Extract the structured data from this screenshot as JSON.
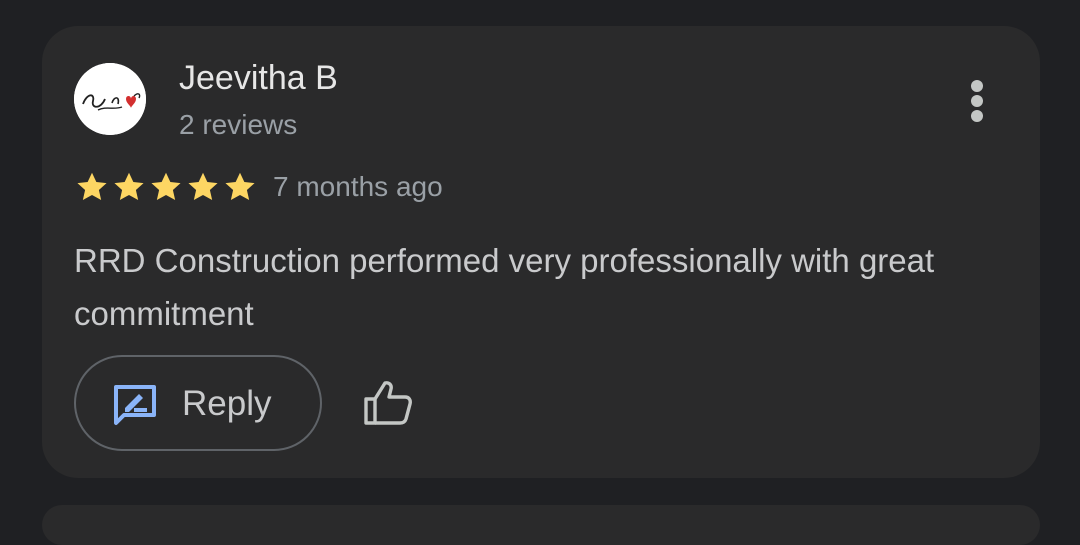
{
  "review": {
    "author_name": "Jeevitha B",
    "review_count": "2 reviews",
    "rating": 5,
    "max_rating": 5,
    "time_ago": "7 months ago",
    "text": "RRD Construction performed very professionally with great commitment",
    "reply_label": "Reply"
  },
  "colors": {
    "star": "#fdd663",
    "accent_icon": "#8ab4f8",
    "card_background": "#2a2a2b",
    "page_background": "#1f2023"
  },
  "icons": {
    "avatar": "profile-avatar",
    "menu": "more-vert-icon",
    "star": "star-icon",
    "reply": "rate-review-icon",
    "like": "thumb-up-icon"
  }
}
